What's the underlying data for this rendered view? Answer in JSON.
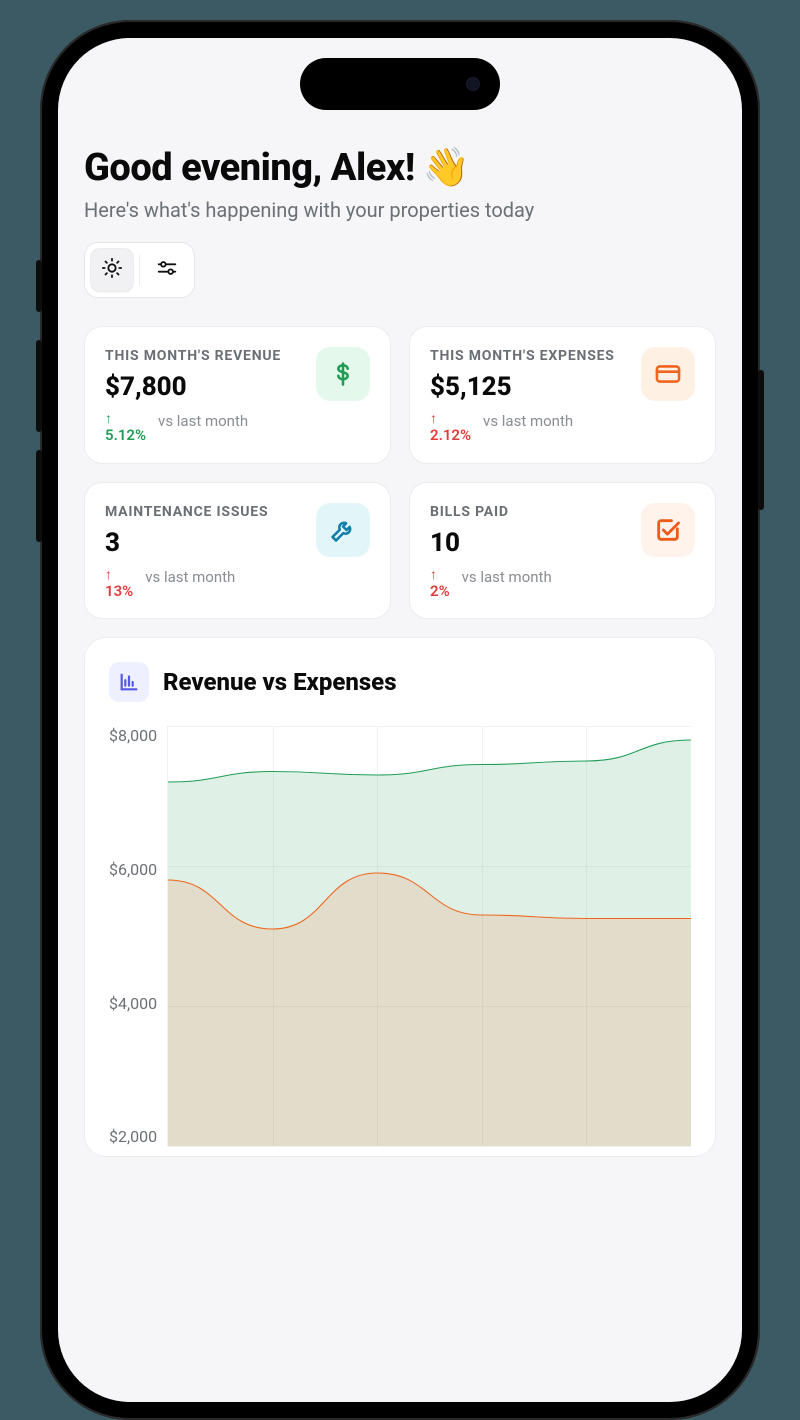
{
  "header": {
    "greeting": "Good evening, Alex!",
    "emoji": "👋",
    "subtitle": "Here's what's happening with your properties today"
  },
  "toolbar": {
    "theme_button": "sun",
    "settings_button": "sliders"
  },
  "cards": [
    {
      "label": "THIS MONTH'S REVENUE",
      "value": "$7,800",
      "delta_pct": "5.12%",
      "delta_dir": "up",
      "delta_color": "green",
      "compare": "vs last month",
      "icon": "dollar",
      "icon_color": "green"
    },
    {
      "label": "THIS MONTH'S EXPENSES",
      "value": "$5,125",
      "delta_pct": "2.12%",
      "delta_dir": "up",
      "delta_color": "red",
      "compare": "vs last month",
      "icon": "credit-card",
      "icon_color": "orange"
    },
    {
      "label": "MAINTENANCE ISSUES",
      "value": "3",
      "delta_pct": "13%",
      "delta_dir": "up",
      "delta_color": "red",
      "compare": "vs last month",
      "icon": "wrench",
      "icon_color": "blue"
    },
    {
      "label": "BILLS PAID",
      "value": "10",
      "delta_pct": "2%",
      "delta_dir": "up",
      "delta_color": "red",
      "compare": "vs last month",
      "icon": "check-square",
      "icon_color": "peach"
    }
  ],
  "chart": {
    "title": "Revenue vs Expenses",
    "y_ticks": [
      "$8,000",
      "$6,000",
      "$4,000",
      "$2,000"
    ]
  },
  "chart_data": {
    "type": "area",
    "title": "Revenue vs Expenses",
    "xlabel": "",
    "ylabel": "",
    "ylim": [
      0,
      8000
    ],
    "x": [
      1,
      2,
      3,
      4,
      5,
      6
    ],
    "series": [
      {
        "name": "Revenue",
        "color": "#1f9d55",
        "values": [
          7200,
          7350,
          7300,
          7450,
          7500,
          7800
        ]
      },
      {
        "name": "Expenses",
        "color": "#f0651d",
        "values": [
          5800,
          5100,
          5900,
          5300,
          5250,
          5250
        ]
      }
    ]
  }
}
